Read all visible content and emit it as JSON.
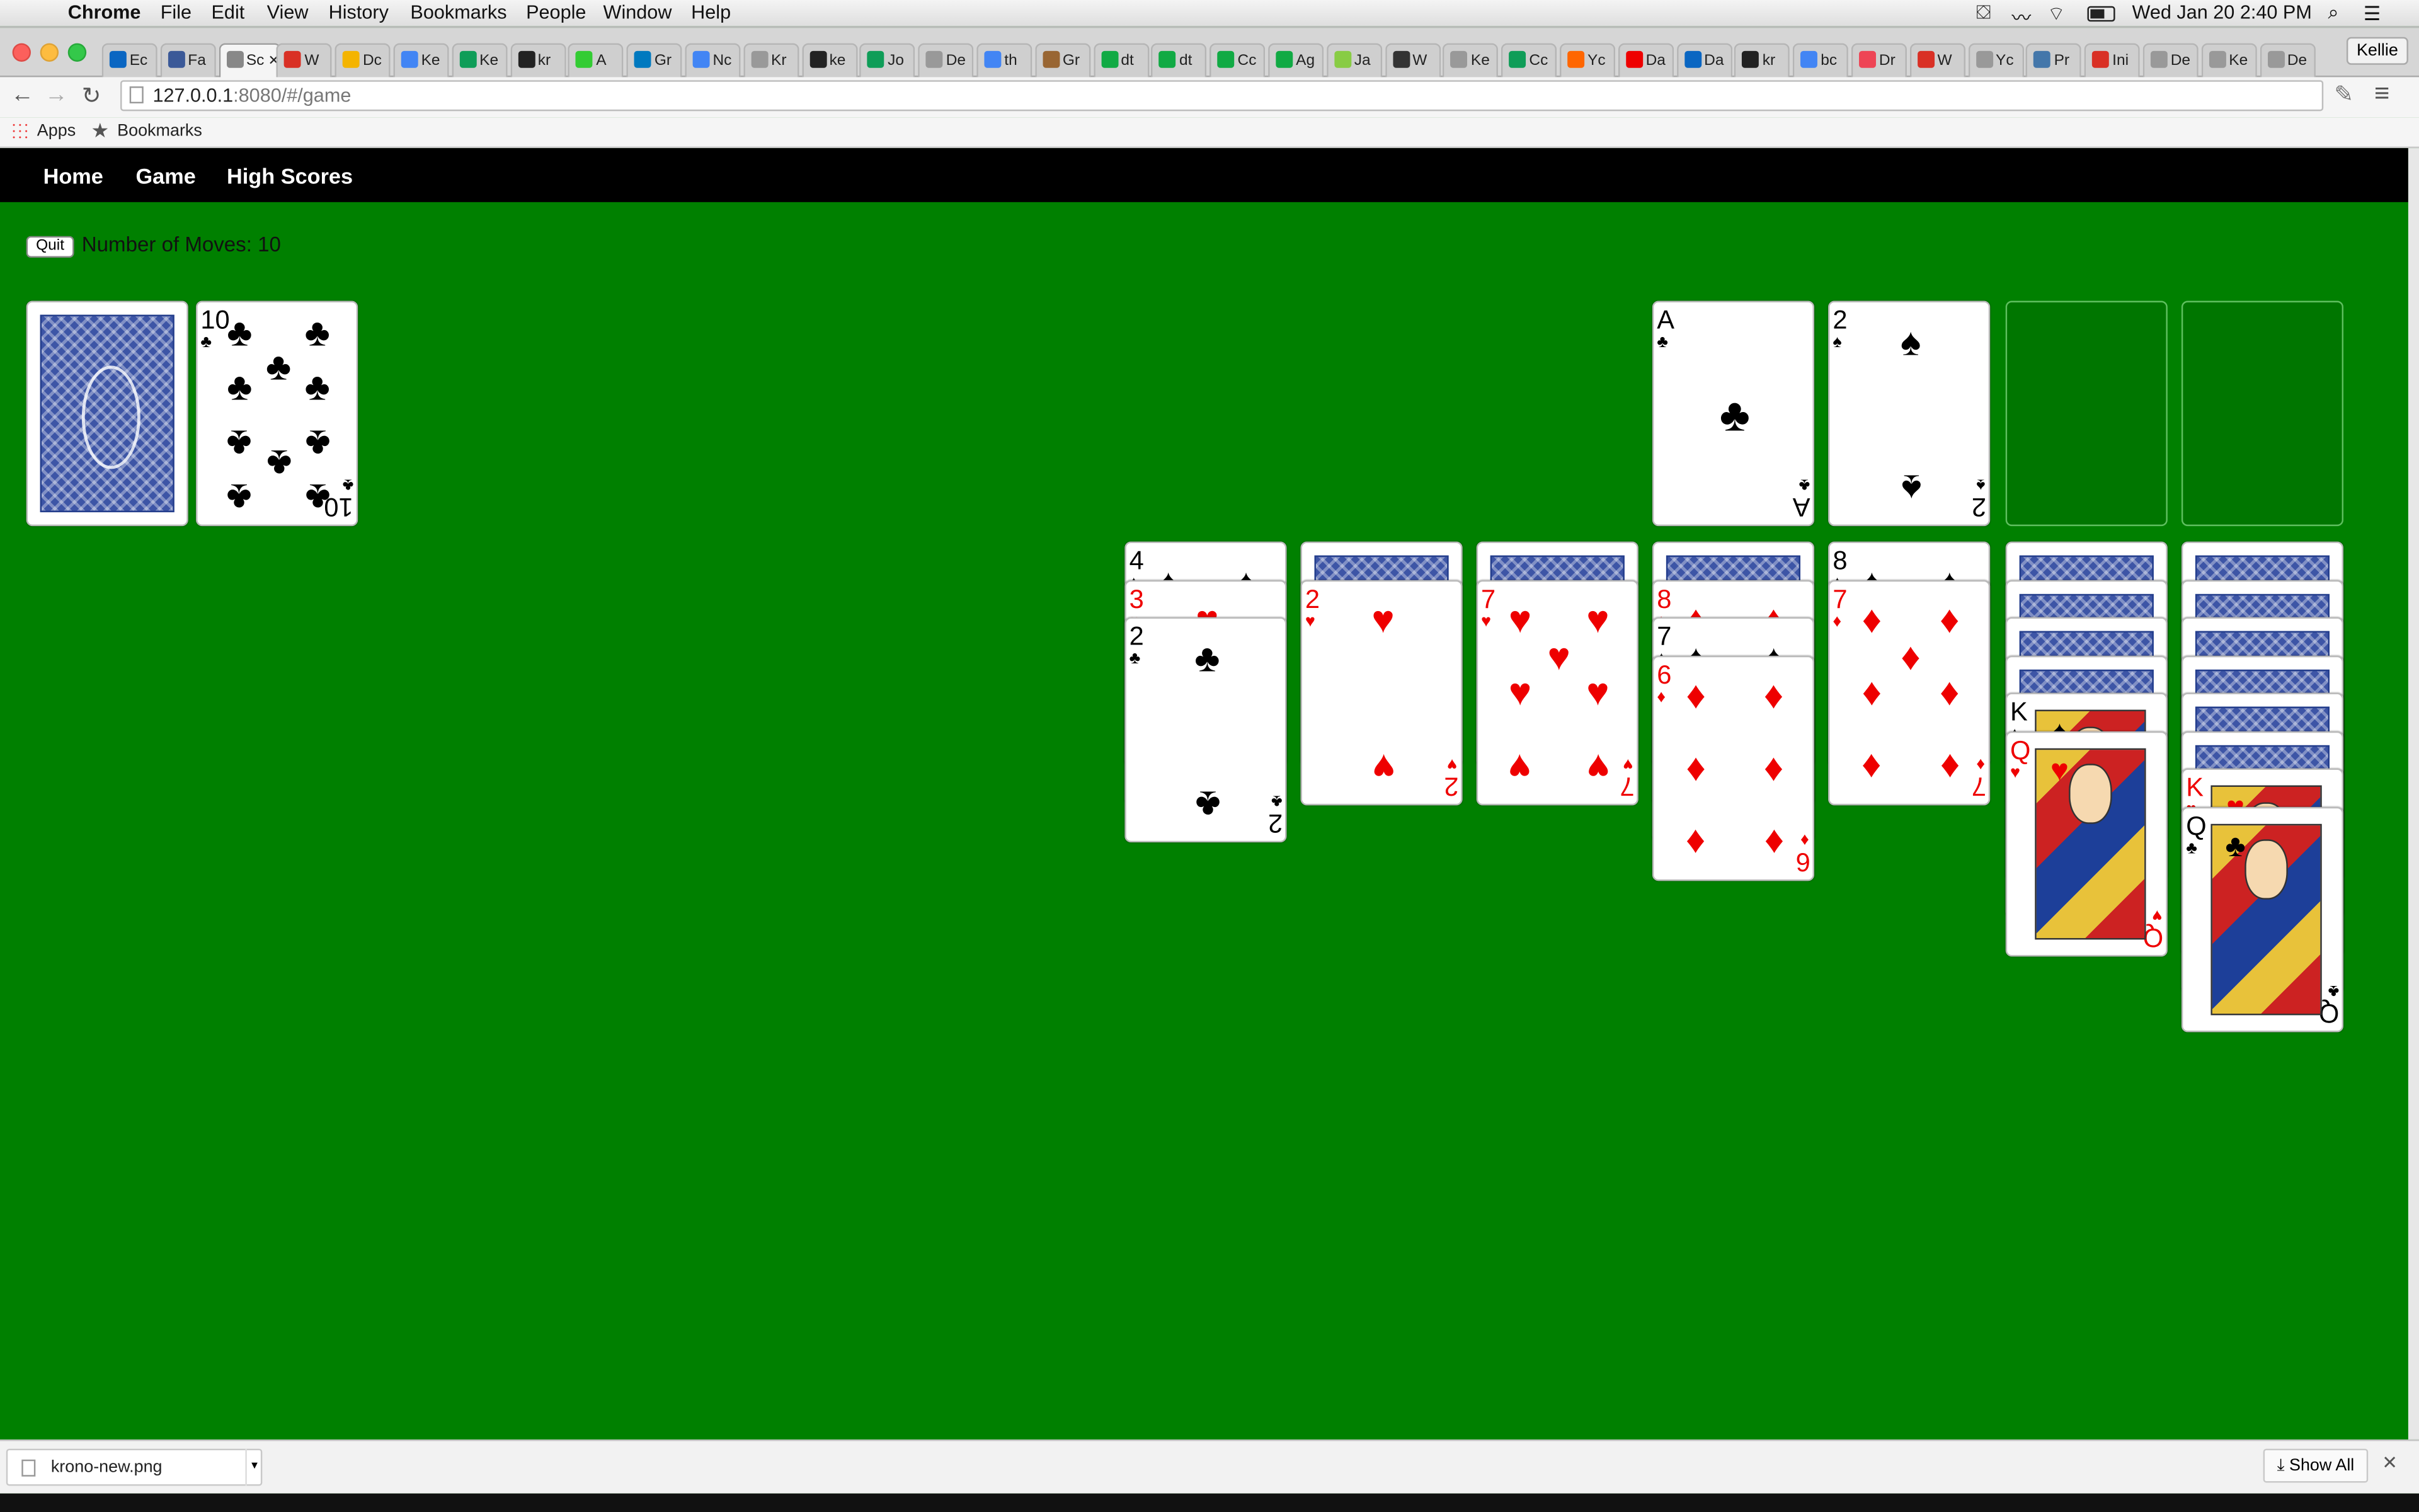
{
  "menubar": {
    "app": "Chrome",
    "items": [
      "File",
      "Edit",
      "View",
      "History",
      "Bookmarks",
      "People",
      "Window",
      "Help"
    ],
    "clock": "Wed Jan 20  2:40 PM"
  },
  "browser": {
    "tabs": [
      "Ec",
      "Fa",
      "Sc",
      "W",
      "Dc",
      "Ke",
      "Ke",
      "kr",
      "A",
      "Gr",
      "Nc",
      "Kr",
      "ke",
      "Jo",
      "De",
      "th",
      "Gr",
      "dt",
      "dt",
      "Cc",
      "Ag",
      "Ja",
      "W",
      "Ke",
      "Cc",
      "Yc",
      "Da",
      "Da",
      "kr",
      "bc",
      "Dr",
      "W",
      "Yc",
      "Pr",
      "Ini",
      "De",
      "Ke",
      "De"
    ],
    "active_tab_index": 2,
    "profile": "Kellie",
    "url_host": "127.0.0.1",
    "url_rest": ":8080/#/game",
    "bookmarks_bar": [
      "Apps",
      "Bookmarks"
    ]
  },
  "nav": {
    "links": [
      "Home",
      "Game",
      "High Scores"
    ]
  },
  "game": {
    "quit_label": "Quit",
    "moves_label": "Number of Moves: 10",
    "moves": 10,
    "waste_card": {
      "rank": "10",
      "suit": "♣",
      "color": "black"
    },
    "foundations": [
      {
        "rank": "A",
        "suit": "♣",
        "color": "black"
      },
      {
        "rank": "2",
        "suit": "♠",
        "color": "black"
      },
      null,
      null
    ],
    "tableau": [
      {
        "hidden": 0,
        "cards": [
          {
            "rank": "4",
            "suit": "♠",
            "color": "black"
          },
          {
            "rank": "3",
            "suit": "♥",
            "color": "red"
          },
          {
            "rank": "2",
            "suit": "♣",
            "color": "black"
          }
        ]
      },
      {
        "hidden": 1,
        "cards": [
          {
            "rank": "2",
            "suit": "♥",
            "color": "red"
          }
        ]
      },
      {
        "hidden": 1,
        "cards": [
          {
            "rank": "7",
            "suit": "♥",
            "color": "red"
          }
        ]
      },
      {
        "hidden": 1,
        "cards": [
          {
            "rank": "8",
            "suit": "♦",
            "color": "red"
          },
          {
            "rank": "7",
            "suit": "♠",
            "color": "black"
          },
          {
            "rank": "6",
            "suit": "♦",
            "color": "red"
          }
        ]
      },
      {
        "hidden": 0,
        "cards": [
          {
            "rank": "8",
            "suit": "♠",
            "color": "black"
          },
          {
            "rank": "7",
            "suit": "♦",
            "color": "red"
          }
        ]
      },
      {
        "hidden": 4,
        "cards": [
          {
            "rank": "K",
            "suit": "♠",
            "color": "black"
          },
          {
            "rank": "Q",
            "suit": "♥",
            "color": "red"
          }
        ]
      },
      {
        "hidden": 6,
        "cards": [
          {
            "rank": "K",
            "suit": "♥",
            "color": "red"
          },
          {
            "rank": "Q",
            "suit": "♣",
            "color": "black"
          }
        ]
      }
    ]
  },
  "downloads": {
    "file": "krono-new.png",
    "show_all": "Show All"
  }
}
